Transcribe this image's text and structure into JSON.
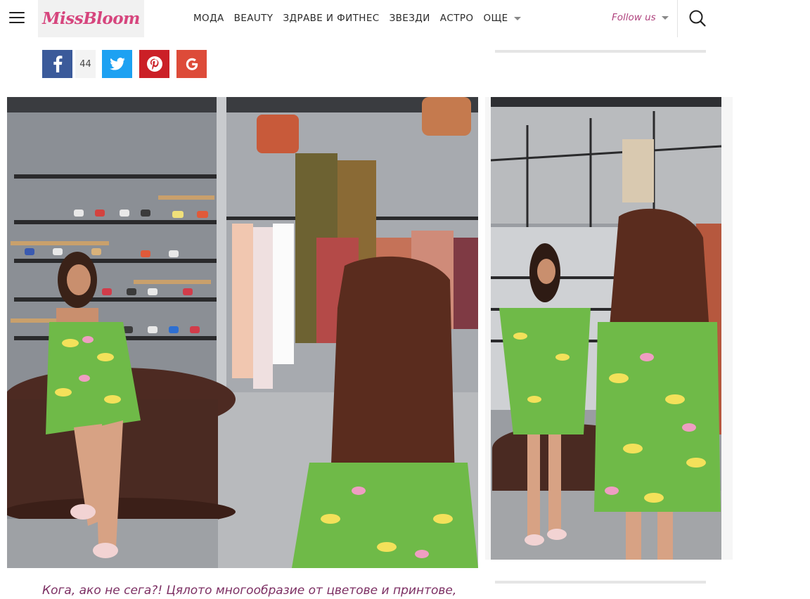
{
  "site": {
    "logo_text": "MissBloom",
    "brand_color": "#d6457d"
  },
  "nav": {
    "items": [
      "МОДА",
      "BEAUTY",
      "ЗДРАВЕ И ФИТНЕС",
      "ЗВЕЗДИ",
      "АСТРО"
    ],
    "more_label": "ОЩЕ",
    "follow_label": "Follow us"
  },
  "icons": {
    "menu": "hamburger-icon",
    "search": "search-icon",
    "facebook": "facebook-icon",
    "twitter": "twitter-icon",
    "pinterest": "pinterest-icon",
    "google": "google-icon"
  },
  "share": {
    "facebook_count": "44",
    "colors": {
      "facebook": "#3b5a9a",
      "twitter": "#1da1f2",
      "pinterest": "#cb2027",
      "google": "#dd4b39"
    }
  },
  "article": {
    "lead_text": "Кога, ако не сега?! Цялото многообразие от цветове и принтове,",
    "lead_color": "#7c2f63"
  }
}
